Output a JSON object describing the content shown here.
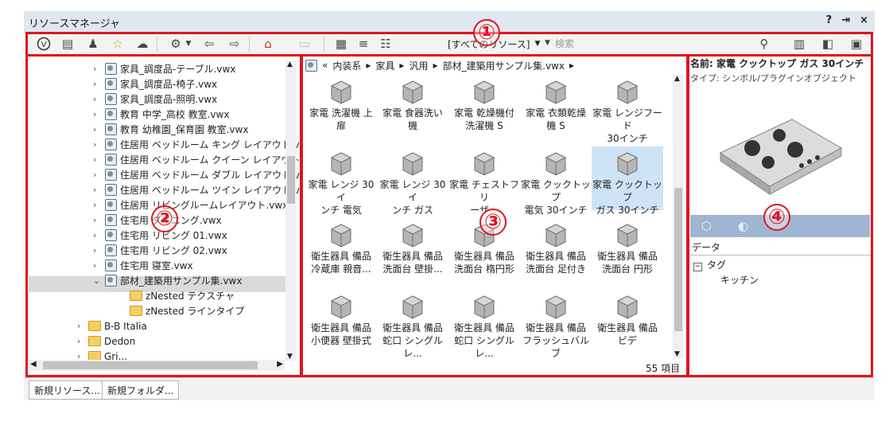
{
  "window": {
    "title": "リソースマネージャ",
    "controls": [
      "?",
      "⇥",
      "×"
    ]
  },
  "toolbar": {
    "filter_value": "[すべてのリソース]",
    "search_placeholder": "検索"
  },
  "tree": {
    "items": [
      {
        "label": "家具_調度品-テーブル.vwx",
        "kind": "file",
        "indent": 1
      },
      {
        "label": "家具_調度品-椅子.vwx",
        "kind": "file",
        "indent": 1
      },
      {
        "label": "家具_調度品-照明.vwx",
        "kind": "file",
        "indent": 1
      },
      {
        "label": "教育 中学_高校 教室.vwx",
        "kind": "file",
        "indent": 1
      },
      {
        "label": "教育 幼稚園_保育園 教室.vwx",
        "kind": "file",
        "indent": 1
      },
      {
        "label": "住居用 ベッドルーム キング レイアウト.vwx",
        "kind": "file",
        "indent": 1
      },
      {
        "label": "住居用 ベッドルーム クイーン レイアウト.vw:",
        "kind": "file",
        "indent": 1
      },
      {
        "label": "住居用 ベッドルーム ダブル レイアウト.vwx",
        "kind": "file",
        "indent": 1
      },
      {
        "label": "住居用 ベッドルーム ツイン レイアウト.vwx",
        "kind": "file",
        "indent": 1
      },
      {
        "label": "住居用 リビングルームレイアウト.vwx",
        "kind": "file",
        "indent": 1
      },
      {
        "label": "住宅用 ダイニング.vwx",
        "kind": "file",
        "indent": 1
      },
      {
        "label": "住宅用 リビング 01.vwx",
        "kind": "file",
        "indent": 1
      },
      {
        "label": "住宅用 リビング 02.vwx",
        "kind": "file",
        "indent": 1
      },
      {
        "label": "住宅用 寝室.vwx",
        "kind": "file",
        "indent": 1
      },
      {
        "label": "部材_建築用サンプル集.vwx",
        "kind": "open-file",
        "indent": 1
      },
      {
        "label": "zNested テクスチャ",
        "kind": "folder",
        "indent": 2
      },
      {
        "label": "zNested ラインタイプ",
        "kind": "folder",
        "indent": 2
      },
      {
        "label": "B-B Italia",
        "kind": "folder",
        "indent": 0
      },
      {
        "label": "Dedon",
        "kind": "folder",
        "indent": 0
      },
      {
        "label": "Gri...",
        "kind": "folder",
        "indent": 0
      }
    ]
  },
  "breadcrumb": [
    "«",
    "内装系",
    "家具",
    "汎用",
    "部材_建築用サンプル集.vwx"
  ],
  "resources": [
    {
      "line1": "家電 洗濯機 上",
      "line2": "扉"
    },
    {
      "line1": "家電 食器洗い",
      "line2": "機"
    },
    {
      "line1": "家電 乾燥機付",
      "line2": "洗濯機 S"
    },
    {
      "line1": "家電 衣類乾燥",
      "line2": "機 S"
    },
    {
      "line1": "家電 レンジフード",
      "line2": "30インチ"
    },
    {
      "line1": "家電 レンジ 30イ",
      "line2": "ンチ 電気"
    },
    {
      "line1": "家電 レンジ 30イ",
      "line2": "ンチ ガス"
    },
    {
      "line1": "家電 チェストフリ",
      "line2": "ーザー"
    },
    {
      "line1": "家電 クックトップ",
      "line2": "電気 30インチ"
    },
    {
      "line1": "家電 クックトップ",
      "line2": "ガス 30インチ"
    },
    {
      "line1": "衛生器具 備品",
      "line2": "冷蔵庫 親音..."
    },
    {
      "line1": "衛生器具 備品",
      "line2": "洗面台 壁掛..."
    },
    {
      "line1": "衛生器具 備品",
      "line2": "洗面台 楕円形"
    },
    {
      "line1": "衛生器具 備品",
      "line2": "洗面台 足付き"
    },
    {
      "line1": "衛生器具 備品",
      "line2": "洗面台 円形"
    },
    {
      "line1": "衛生器具 備品",
      "line2": "小便器 壁掛式"
    },
    {
      "line1": "衛生器具 備品",
      "line2": "蛇口 シングルレ..."
    },
    {
      "line1": "衛生器具 備品",
      "line2": "蛇口 シングルレ..."
    },
    {
      "line1": "衛生器具 備品",
      "line2": "フラッシュバルブ"
    },
    {
      "line1": "衛生器具 備品",
      "line2": "ビデ"
    }
  ],
  "item_count": "55 項目",
  "details": {
    "name": "名前: 家電 クックトップ ガス 30インチ",
    "type": "タイプ: シンボル/プラグインオブジェクト",
    "data_header": "データ",
    "tag_label": "タグ",
    "tag_value": "キッチン"
  },
  "bottom": {
    "new_resource": "新規リソース...",
    "new_folder": "新規フォルダ..."
  },
  "annotations": [
    "①",
    "②",
    "③",
    "④"
  ],
  "colors": {
    "annotation": "#e0141e",
    "selection": "#cfe3f7",
    "preview_bar": "#9fb6d2"
  }
}
